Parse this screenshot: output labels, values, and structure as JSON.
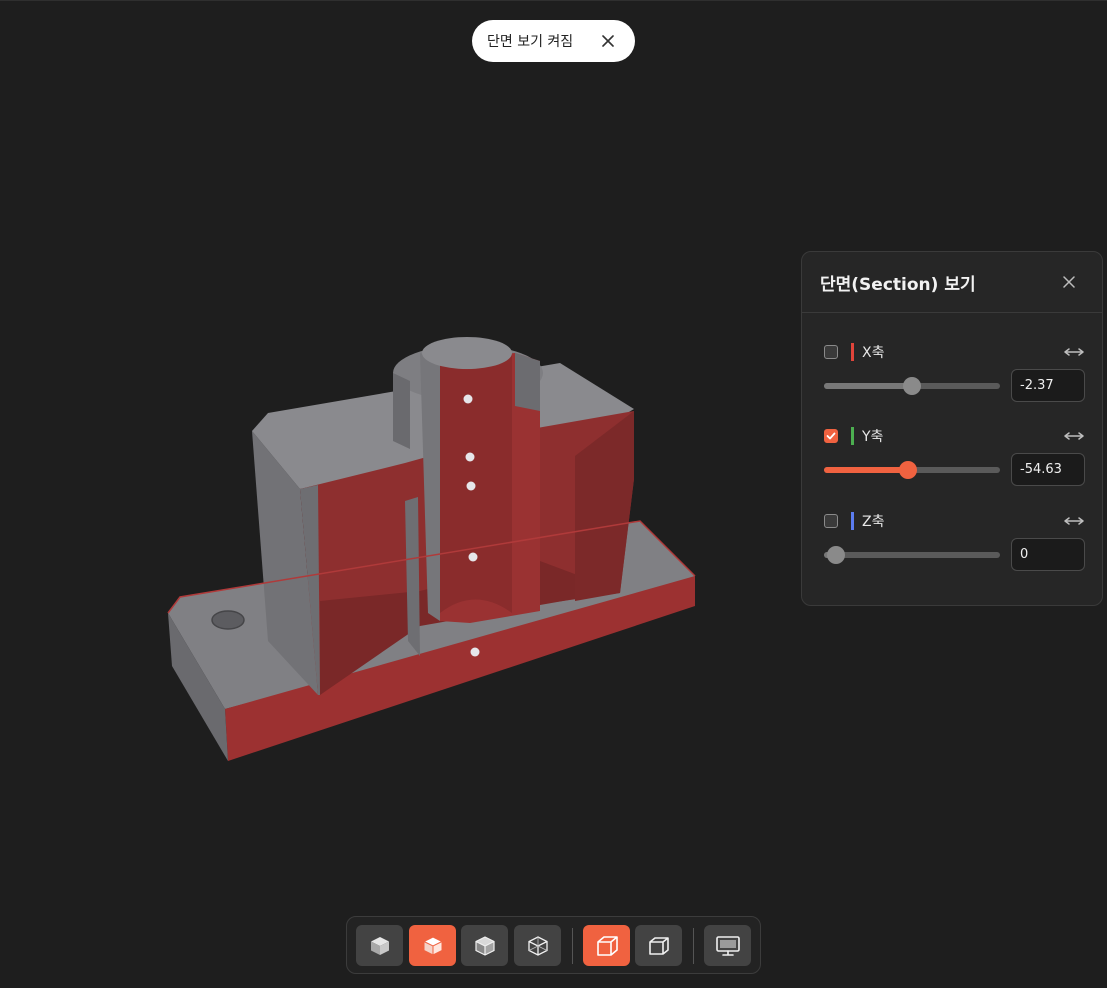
{
  "toast": {
    "text": "단면 보기 켜짐"
  },
  "panel": {
    "title": "단면(Section) 보기",
    "axes": [
      {
        "label": "X축",
        "checked": false,
        "value": "-2.37",
        "slider_fraction": 0.5,
        "color": "#e0443a"
      },
      {
        "label": "Y축",
        "checked": true,
        "value": "-54.63",
        "slider_fraction": 0.48,
        "color": "#4caf50"
      },
      {
        "label": "Z축",
        "checked": false,
        "value": "0",
        "slider_fraction": 0.07,
        "color": "#5b7cf0"
      }
    ]
  },
  "toolbar": {
    "buttons": [
      {
        "icon": "solid-cube-icon",
        "active": false
      },
      {
        "icon": "shaded-edges-cube-icon",
        "active": true
      },
      {
        "icon": "transparent-cube-icon",
        "active": false
      },
      {
        "icon": "wireframe-cube-icon",
        "active": false
      },
      {
        "icon": "perspective-box-icon",
        "active": true
      },
      {
        "icon": "orthographic-box-icon",
        "active": false
      },
      {
        "icon": "monitor-icon",
        "active": false
      }
    ]
  },
  "colors": {
    "accent": "#f06240",
    "section_cut": "#8e2f2f",
    "model_gray": "#7a7a7e",
    "background": "#1e1e1e"
  }
}
